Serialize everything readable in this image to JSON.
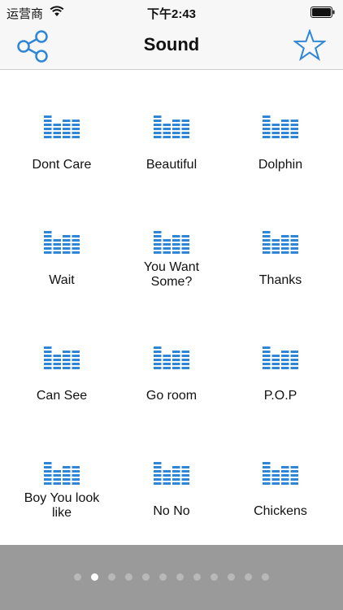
{
  "status_bar": {
    "carrier": "运营商",
    "time": "下午2:43"
  },
  "nav": {
    "title": "Sound",
    "left_icon": "share-icon",
    "right_icon": "star-icon"
  },
  "colors": {
    "accent": "#2f86d6",
    "pager_bg": "#9a9a9a",
    "dot_inactive": "#b8b8b8",
    "dot_active": "#ffffff"
  },
  "sounds": [
    {
      "label": "Dont Care",
      "icon": "equalizer-icon"
    },
    {
      "label": "Beautiful",
      "icon": "equalizer-icon"
    },
    {
      "label": "Dolphin",
      "icon": "equalizer-icon"
    },
    {
      "label": "Wait",
      "icon": "equalizer-icon"
    },
    {
      "label": "You Want\nSome?",
      "icon": "equalizer-icon"
    },
    {
      "label": "Thanks",
      "icon": "equalizer-icon"
    },
    {
      "label": "Can See",
      "icon": "equalizer-icon"
    },
    {
      "label": "Go room",
      "icon": "equalizer-icon"
    },
    {
      "label": "P.O.P",
      "icon": "equalizer-icon"
    },
    {
      "label": "Boy You look\nlike",
      "icon": "equalizer-icon"
    },
    {
      "label": "No No",
      "icon": "equalizer-icon"
    },
    {
      "label": "Chickens",
      "icon": "equalizer-icon"
    }
  ],
  "pager": {
    "page_count": 12,
    "current_page": 2
  }
}
